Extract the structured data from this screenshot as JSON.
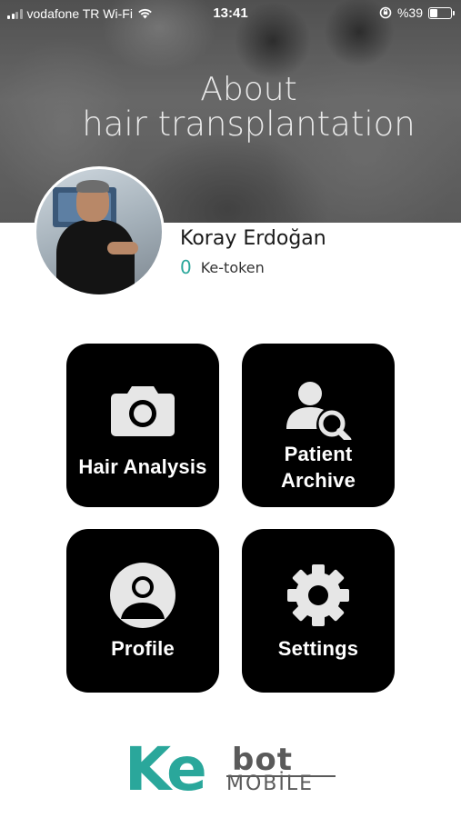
{
  "status_bar": {
    "carrier": "vodafone TR Wi-Fi",
    "time": "13:41",
    "battery_text": "%39",
    "battery_level": 0.39,
    "signal_icon": "signal-bars-icon",
    "wifi_icon": "wifi-icon",
    "orientation_lock_icon": "orientation-lock-icon"
  },
  "hero": {
    "title_line1": "About",
    "title_line2": "hair transplantation"
  },
  "user": {
    "name": "Koray Erdoğan",
    "token_count": "0",
    "token_label": "Ke-token"
  },
  "menu": {
    "hair_analysis": "Hair Analysis",
    "patient_archive_line1": "Patient",
    "patient_archive_line2": "Archive",
    "profile": "Profile",
    "settings": "Settings"
  },
  "logo": {
    "part1": "Ke",
    "part2": "bot",
    "part3": "MOBİLE",
    "accent_color": "#2aa79b",
    "dark_color": "#5a5a5a"
  },
  "colors": {
    "tile_bg": "#000000",
    "accent": "#2aa79b"
  }
}
